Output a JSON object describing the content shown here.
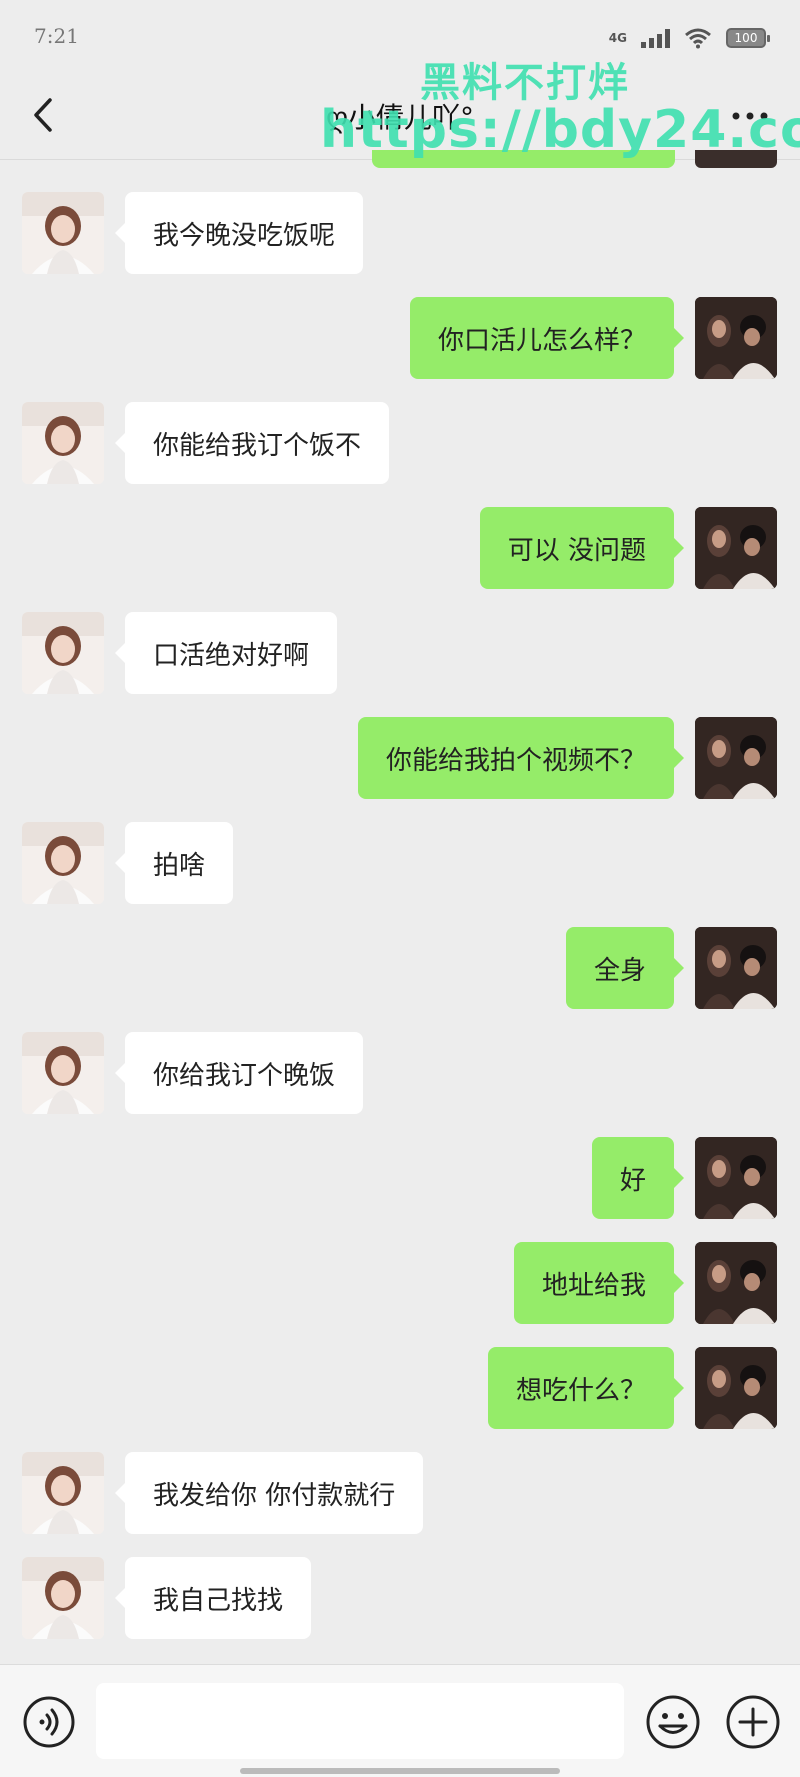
{
  "status_bar": {
    "time": "7:21",
    "network": "4G",
    "battery": "100"
  },
  "header": {
    "title": "ღ小倩儿吖°"
  },
  "watermark": {
    "line1": "黑料不打烊",
    "line2": "https://bdy24.co"
  },
  "messages": [
    {
      "side": "left",
      "text": "我今晚没吃饭呢"
    },
    {
      "side": "right",
      "text": "你口活儿怎么样？"
    },
    {
      "side": "left",
      "text": "你能给我订个饭不"
    },
    {
      "side": "right",
      "text": "可以 没问题"
    },
    {
      "side": "left",
      "text": "口活绝对好啊"
    },
    {
      "side": "right",
      "text": "你能给我拍个视频不？"
    },
    {
      "side": "left",
      "text": "拍啥"
    },
    {
      "side": "right",
      "text": "全身"
    },
    {
      "side": "left",
      "text": "你给我订个晚饭"
    },
    {
      "side": "right",
      "text": "好"
    },
    {
      "side": "right",
      "text": "地址给我"
    },
    {
      "side": "right",
      "text": "想吃什么？"
    },
    {
      "side": "left",
      "text": "我发给你 你付款就行"
    },
    {
      "side": "left",
      "text": "我自己找找"
    }
  ],
  "input": {
    "value": "",
    "placeholder": ""
  },
  "colors": {
    "background": "#ededed",
    "outgoing_bubble": "#95ec69",
    "incoming_bubble": "#ffffff",
    "watermark": "#3fe0b0"
  },
  "icons": {
    "back": "chevron-left-icon",
    "more": "more-dots-icon",
    "voice": "voice-icon",
    "emoji": "emoji-icon",
    "plus": "plus-icon"
  }
}
